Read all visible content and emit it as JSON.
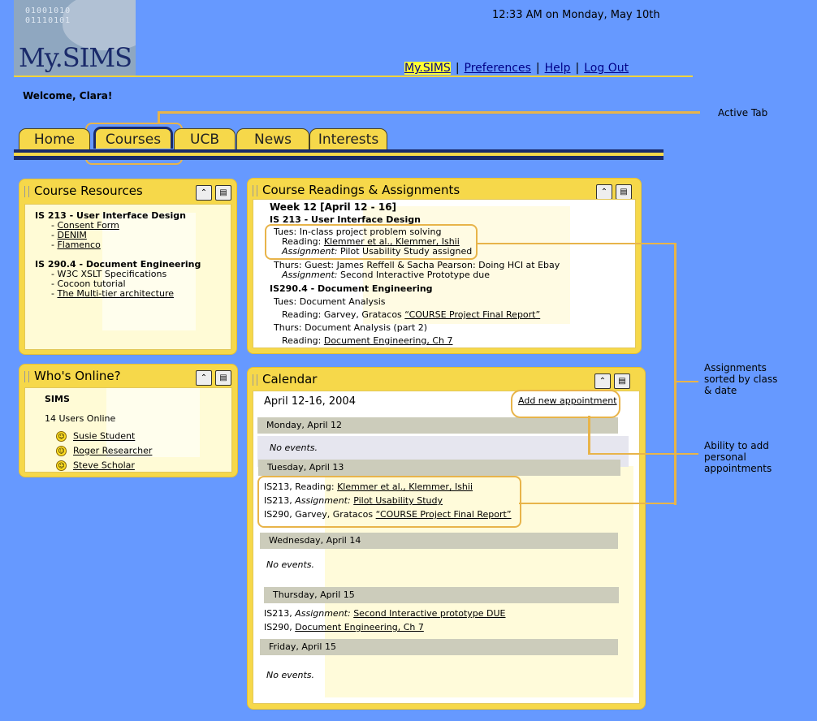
{
  "app": {
    "brand": "My.SIMS",
    "logo_bits": [
      "01001010",
      "01110101"
    ]
  },
  "clock": "12:33 AM on Monday, May 10th",
  "topnav": {
    "current": "My.SIMS",
    "preferences": "Preferences",
    "help": "Help",
    "logout": "Log Out",
    "sep": "|"
  },
  "welcome": "Welcome, Clara!",
  "annotations": {
    "active_tab": "Active Tab",
    "assignments": [
      "Assignments",
      "sorted by class",
      "& date"
    ],
    "appointments": [
      "Ability to add",
      "personal",
      "appointments"
    ]
  },
  "tabs": [
    "Home",
    "Courses",
    "UCB",
    "News",
    "Interests"
  ],
  "icons": {
    "collapse": "double-chevron-up-icon",
    "trash": "trash-icon",
    "smiley": "smiley-icon"
  },
  "colors": {
    "background": "#6699ff",
    "panel": "#f6d84a",
    "panel_body": "#fffbd6",
    "accent": "#e8b44a",
    "navy": "#1a2a6a"
  },
  "course_resources": {
    "title": "Course Resources",
    "courses": [
      {
        "name": "IS 213 - User Interface Design",
        "items": [
          "Consent Form",
          "DENIM",
          "Flamenco"
        ]
      },
      {
        "name": "IS 290.4 - Document Engineering",
        "items": [
          "W3C XSLT Specifications",
          "Cocoon tutorial",
          "The Multi-tier architecture"
        ]
      }
    ]
  },
  "whos_online": {
    "title": "Who's Online?",
    "group": "SIMS",
    "count": "14 Users Online",
    "users": [
      "Susie Student",
      "Roger Researcher",
      "Steve Scholar"
    ]
  },
  "readings": {
    "title": "Course Readings & Assignments",
    "week": "Week 12 [April 12 - 16]",
    "c1": "IS 213 - User Interface Design",
    "tues_label": "Tues: In-class project problem solving",
    "reading_label": "Reading:",
    "reading_link": "Klemmer et al., Klemmer, Ishii",
    "assignment_label": "Assignment:",
    "assignment_text": "Pilot Usability Study assigned",
    "thurs_label": "Thurs: Guest: James Reffell & Sacha Pearson: Doing HCI at Ebay",
    "assignment2_text": "Second Interactive Prototype due",
    "c2": "IS290.4 - Document Engineering",
    "tues2": "Tues: Document Analysis",
    "reading2_text": "Garvey, Gratacos",
    "reading2_link": "“COURSE Project Final Report”",
    "thurs2": "Thurs: Document Analysis (part 2)",
    "reading3_link": "Document Engineering, Ch 7"
  },
  "calendar": {
    "title": "Calendar",
    "range": "April 12-16, 2004",
    "add_link": "Add new appointment",
    "no_events": "No events.",
    "days": [
      "Monday, April 12",
      "Tuesday, April 13",
      "Wednesday, April 14",
      "Thursday, April 15",
      "Friday, April 15"
    ],
    "tue": {
      "e1_prefix": "IS213, Reading:",
      "e1_link": "Klemmer et al., Klemmer, Ishii",
      "e2_prefix": "IS213,",
      "e2_em": "Assignment:",
      "e2_link": "Pilot Usability Study",
      "e3_prefix": "IS290, Garvey, Gratacos",
      "e3_link": "“COURSE Project Final Report”"
    },
    "thu": {
      "e1_prefix": "IS213,",
      "e1_em": "Assignment:",
      "e1_link": "Second Interactive prototype DUE",
      "e2_prefix": "IS290,",
      "e2_link": "Document Engineering, Ch 7"
    }
  }
}
